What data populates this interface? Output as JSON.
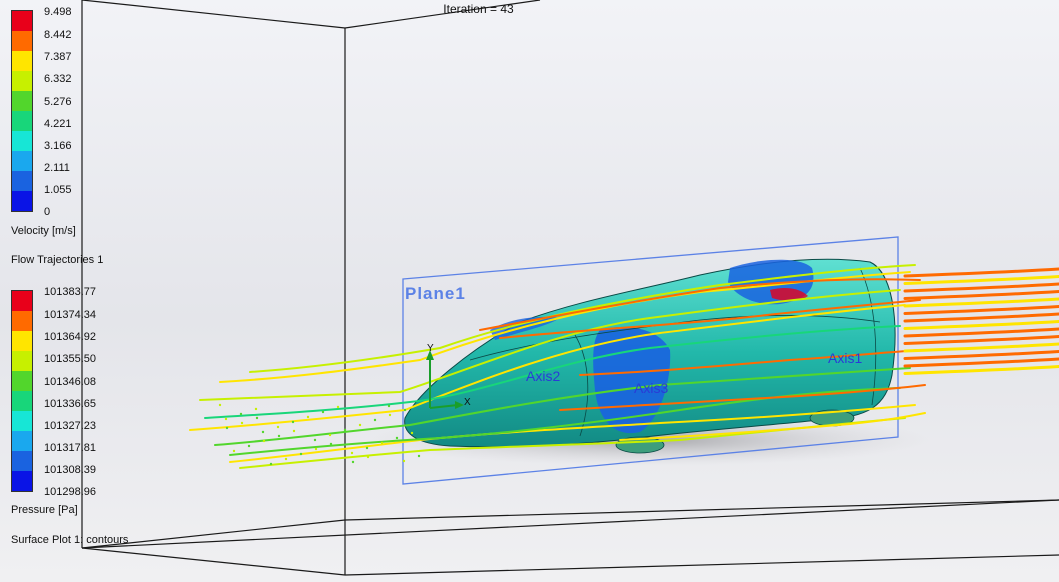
{
  "header": {
    "iteration": "Iteration = 43"
  },
  "velocity_legend": {
    "ticks": [
      "9.498",
      "8.442",
      "7.387",
      "6.332",
      "5.276",
      "4.221",
      "3.166",
      "2.111",
      "1.055",
      "0"
    ],
    "title": "Velocity [m/s]"
  },
  "flow_trajectories_label": "Flow Trajectories 1",
  "pressure_legend": {
    "ticks": [
      "101383.77",
      "101374.34",
      "101364.92",
      "101355.50",
      "101346.08",
      "101336.65",
      "101327.23",
      "101317.81",
      "101308.39",
      "101298.96"
    ],
    "title": "Pressure [Pa]"
  },
  "surface_plot_label": "Surface Plot 1: contours",
  "scene": {
    "plane_label": "Plane1",
    "axis_labels": [
      "Axis2",
      "Axis3",
      "Axis1"
    ],
    "triad": {
      "y": "Y",
      "x": "X"
    }
  },
  "colors": {
    "scale": [
      "#e8001a",
      "#ff6a00",
      "#ffe500",
      "#c7f000",
      "#52d62c",
      "#18d67a",
      "#17e6d6",
      "#1aa8ee",
      "#1a63e0",
      "#0a14e6"
    ],
    "car_body": "#26bfb1",
    "plane_outline": "#5c82e6",
    "axis_text": "#2a3bd6"
  }
}
